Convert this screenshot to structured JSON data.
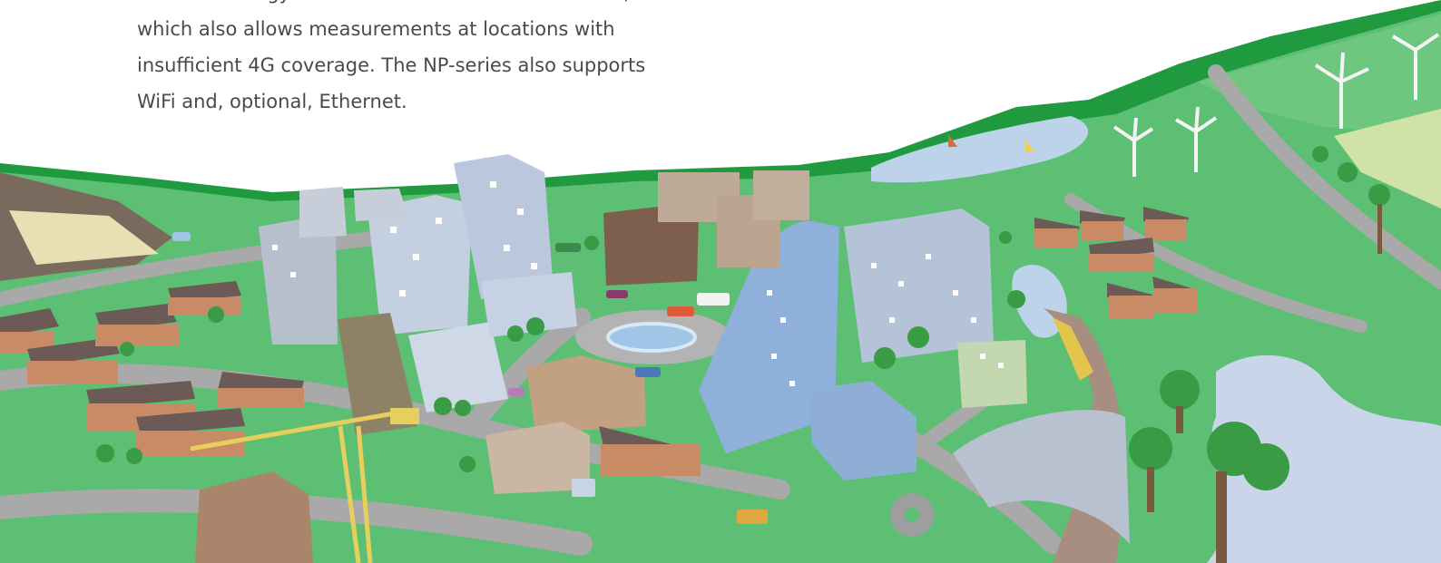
{
  "intro": {
    "lines": [
      "uses the energy-efficient IoT communication LTE-M,",
      "which also allows measurements at locations with",
      "insufficient 4G coverage. The NP-series also supports",
      "WiFi and, optional, Ethernet."
    ]
  },
  "colors": {
    "grass": "#5cbf74",
    "road": "#a9a9a9",
    "water": "#bcd3ea",
    "brick": "#c98a66",
    "roof": "#6b5a55",
    "glass": "#b8c6db",
    "text": "#4a4a4a"
  }
}
